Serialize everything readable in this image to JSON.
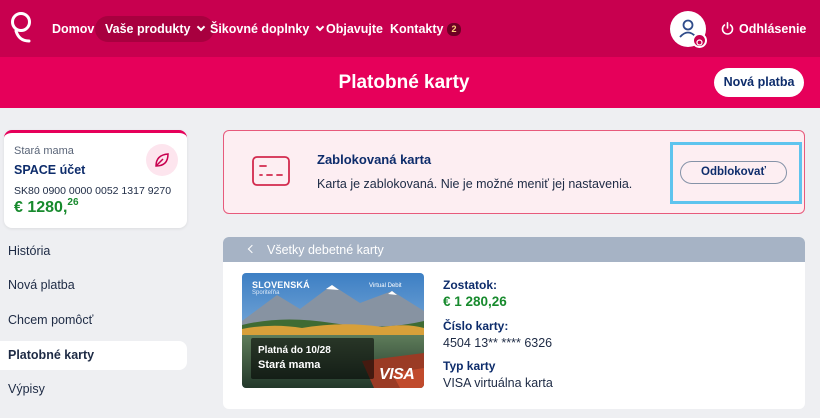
{
  "colors": {
    "brand": "#c8004f",
    "brand_light": "#e6005a",
    "accent_blue": "#0d2c6b",
    "positive": "#178a2d",
    "highlight": "#5ec4ee"
  },
  "nav": {
    "items": [
      {
        "label": "Domov"
      },
      {
        "label": "Vaše produkty"
      },
      {
        "label": "Šikovné doplnky"
      },
      {
        "label": "Objavujte"
      },
      {
        "label": "Kontakty",
        "badge": "2"
      }
    ],
    "logout": "Odhlásenie"
  },
  "header": {
    "title": "Platobné karty",
    "new_payment": "Nová platba"
  },
  "account": {
    "owner": "Stará mama",
    "name": "SPACE účet",
    "iban": "SK80 0900 0000 0052 1317 9270",
    "balance_main": "€ 1280,",
    "balance_cents": "26",
    "icon": "leaf-icon"
  },
  "sidebar": {
    "items": [
      {
        "label": "História"
      },
      {
        "label": "Nová platba"
      },
      {
        "label": "Chcem pomôcť"
      },
      {
        "label": "Platobné karty",
        "active": true
      },
      {
        "label": "Výpisy"
      }
    ]
  },
  "alert": {
    "title": "Zablokovaná karta",
    "text": "Karta je zablokovaná. Nie je možné meniť jej nastavenia.",
    "button": "Odblokovať"
  },
  "cards_panel": {
    "back_label": "Všetky debetné karty",
    "card": {
      "bank": "SLOVENSKÁ",
      "bank_sub": "Sporiteľňa",
      "type_tag": "Virtual Debit",
      "valid": "Platná do 10/28",
      "holder": "Stará mama",
      "network": "VISA"
    },
    "balance_label": "Zostatok:",
    "balance_value": "€ 1 280,26",
    "number_label": "Číslo karty:",
    "number_value": "4504 13** **** 6326",
    "type_label": "Typ karty",
    "type_value": "VISA virtuálna karta"
  }
}
